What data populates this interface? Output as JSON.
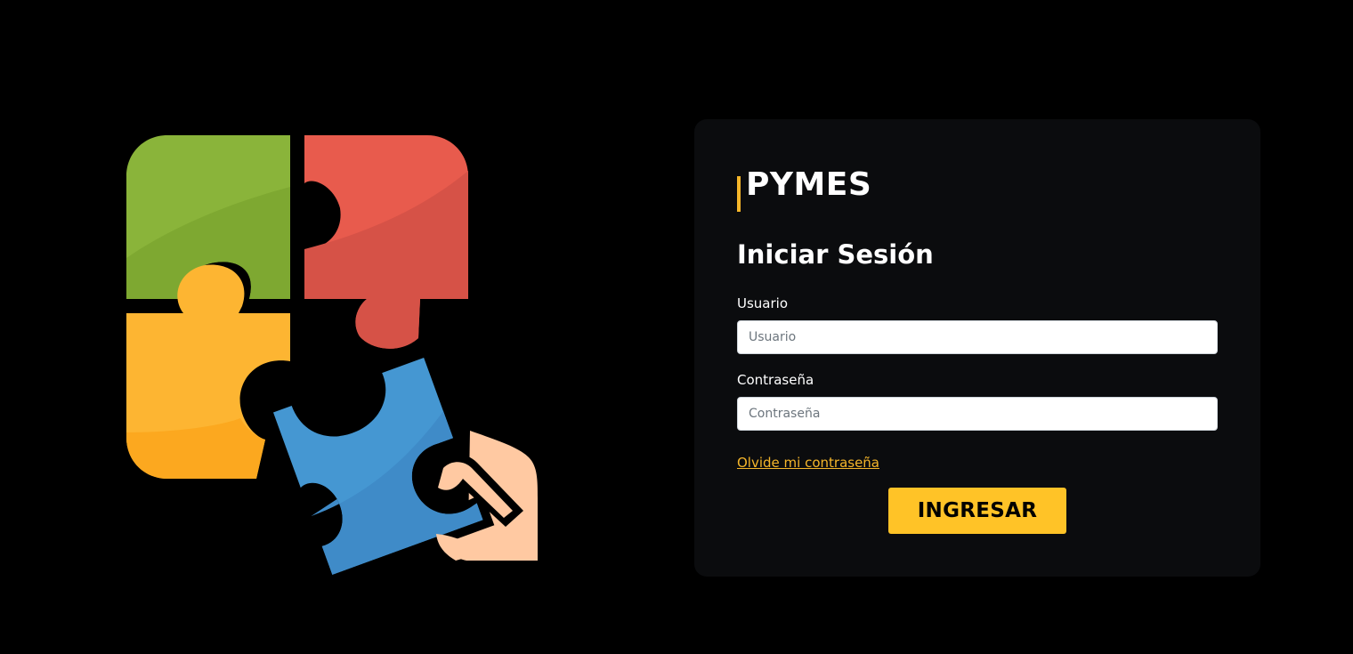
{
  "brand": {
    "name": "PYMES",
    "accent_color": "#f5b62a"
  },
  "login": {
    "title": "Iniciar Sesión",
    "username": {
      "label": "Usuario",
      "placeholder": "Usuario",
      "value": ""
    },
    "password": {
      "label": "Contraseña",
      "placeholder": "Contraseña",
      "value": ""
    },
    "forgot_link": "Olvide mi contraseña",
    "submit_label": "INGRESAR",
    "submit_color": "#ffc327"
  },
  "illustration": {
    "icon": "puzzle-hand-icon",
    "colors": {
      "green": "#8ab43a",
      "red": "#e85b4d",
      "yellow": "#fdb532",
      "blue": "#4597d2",
      "skin": "#ffc9a2"
    }
  }
}
